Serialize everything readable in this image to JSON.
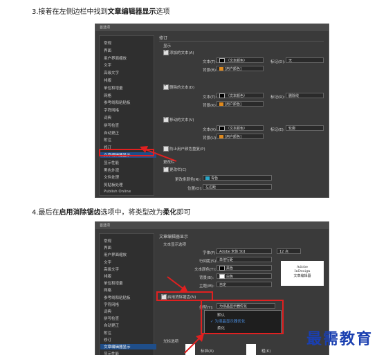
{
  "step3": {
    "prefix": "3.接着在左侧边栏中找到",
    "bold": "文章编辑器显示",
    "suffix": "选项"
  },
  "step4": {
    "prefix": "4.最后在",
    "bold1": "启用消除锯齿",
    "mid": "选项中，将类型改为",
    "bold2": "柔化",
    "suffix": "即可"
  },
  "shot1": {
    "title": "首选项",
    "sidebar": [
      "常规",
      "界面",
      "用户界面缩放",
      "文字",
      "高级文字",
      "排版",
      "单位和增量",
      "网格",
      "参考线和粘贴板",
      "字符网格",
      "词典",
      "拼写检查",
      "自动更正",
      "附注",
      "修订",
      "文章编辑器显示",
      "显示性能",
      "黑色外观",
      "文件处理",
      "剪贴板处理",
      "Publish Online"
    ],
    "selected_index": 15,
    "heading": "修订",
    "section": "显示",
    "added": {
      "check": "添加的文本(A)",
      "text_label": "文本(T):",
      "text_val": "（文本颜色）",
      "bg_label": "背景(B):",
      "bg_val": "[用户颜色]",
      "mark_label": "标记(D):",
      "mark_val": "无"
    },
    "deleted": {
      "check": "删除的文本(D)",
      "text_label": "文本(T):",
      "text_val": "（文本颜色）",
      "bg_label": "背景(K):",
      "bg_val": "[用户颜色]",
      "mark_label": "标记(R):",
      "mark_val": "删除线"
    },
    "moved": {
      "check": "移动的文本(V)",
      "text_label": "文本(X):",
      "text_val": "（文本颜色）",
      "bg_label": "背景(U):",
      "bg_val": "[用户颜色]",
      "mark_label": "标记(E):",
      "mark_val": "轮廓"
    },
    "prevent": "防止用户颜色重复(P)",
    "changebar_section": "更改栏",
    "changebar_check": "更改栏(C)",
    "changebar_color_label": "更改条颜色(R):",
    "changebar_color_val": "青色",
    "position_label": "位置(O):",
    "position_val": "左边距",
    "colors": {
      "teal": "#2aa7c9",
      "orange": "#e08a1e",
      "black": "#000000"
    }
  },
  "shot2": {
    "title": "首选项",
    "sidebar": [
      "常规",
      "界面",
      "用户界面缩放",
      "文字",
      "高级文字",
      "排版",
      "单位和增量",
      "网格",
      "参考线和粘贴板",
      "字符网格",
      "词典",
      "拼写检查",
      "自动更正",
      "附注",
      "修订",
      "文章编辑器显示",
      "显示性能"
    ],
    "selected_index": 15,
    "heading": "文章编辑器显示",
    "section": "文本显示选项",
    "font_label": "字体(F):",
    "font_val": "Adobe 宋体 Std",
    "size_val": "12 点",
    "spacing_label": "行间距(S):",
    "spacing_val": "单倍行距",
    "textcolor_label": "文本颜色(T):",
    "textcolor_val": "黑色",
    "bg_label": "背景(B):",
    "bg_val": "白色",
    "theme_label": "主题(M):",
    "theme_val": "自定",
    "antialias": "启用消除锯齿(N)",
    "type_label": "类型(Y):",
    "type_val": "为液晶显示器优化",
    "dropdown_items": [
      "默认",
      "为液晶显示器优化",
      "柔化"
    ],
    "cursor_section": "光标选项",
    "cursor_opts": [
      "标准(A)",
      "粗(K)",
      "条(C)",
      "块(L)"
    ],
    "preview_lines": [
      "Adobe",
      "InDesign",
      "文章编辑器"
    ],
    "colors": {
      "red": "#e02020",
      "highlight": "#1f4e8a"
    }
  },
  "watermark": "最需教育"
}
